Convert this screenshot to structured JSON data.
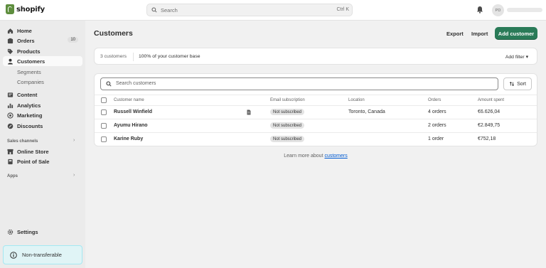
{
  "topbar": {
    "logo_text": "shopify",
    "search_placeholder": "Search",
    "search_shortcut": "Ctrl K",
    "avatar_initials": "PD"
  },
  "sidebar": {
    "items": [
      {
        "label": "Home",
        "icon": "home-icon"
      },
      {
        "label": "Orders",
        "icon": "orders-icon",
        "badge": "10"
      },
      {
        "label": "Products",
        "icon": "tag-icon"
      },
      {
        "label": "Customers",
        "icon": "person-icon",
        "active": true
      },
      {
        "label": "Segments",
        "sub": true
      },
      {
        "label": "Companies",
        "sub": true
      },
      {
        "label": "Content",
        "icon": "content-icon"
      },
      {
        "label": "Analytics",
        "icon": "chart-icon"
      },
      {
        "label": "Marketing",
        "icon": "target-icon"
      },
      {
        "label": "Discounts",
        "icon": "discount-icon"
      }
    ],
    "sales_channels_label": "Sales channels",
    "sales_channels": [
      {
        "label": "Online Store",
        "icon": "store-icon"
      },
      {
        "label": "Point of Sale",
        "icon": "pos-icon"
      }
    ],
    "apps_label": "Apps",
    "settings_label": "Settings",
    "non_transferable_label": "Non-transferable"
  },
  "main": {
    "title": "Customers",
    "export_label": "Export",
    "import_label": "Import",
    "add_label": "Add customer",
    "stats": {
      "count": "3 customers",
      "share": "100% of your customer base",
      "filter_label": "Add filter"
    },
    "table": {
      "search_placeholder": "Search customers",
      "sort_label": "Sort",
      "headers": [
        "Customer name",
        "Email subscription",
        "Location",
        "Orders",
        "Amount spent"
      ],
      "rows": [
        {
          "name": "Russell Winfield",
          "has_note": true,
          "subscription": "Not subscribed",
          "location": "Toronto, Canada",
          "orders": "4 orders",
          "amount": "€6.626,04"
        },
        {
          "name": "Ayumu Hirano",
          "has_note": false,
          "subscription": "Not subscribed",
          "location": "",
          "orders": "2 orders",
          "amount": "€2.849,75"
        },
        {
          "name": "Karine Ruby",
          "has_note": false,
          "subscription": "Not subscribed",
          "location": "",
          "orders": "1 order",
          "amount": "€752,18"
        }
      ]
    },
    "learn_more": {
      "prefix": "Learn more about ",
      "link": "customers"
    }
  },
  "colors": {
    "primary_button": "#2a7b58",
    "link": "#005bd3",
    "sidebar_bg": "#ebebeb"
  }
}
